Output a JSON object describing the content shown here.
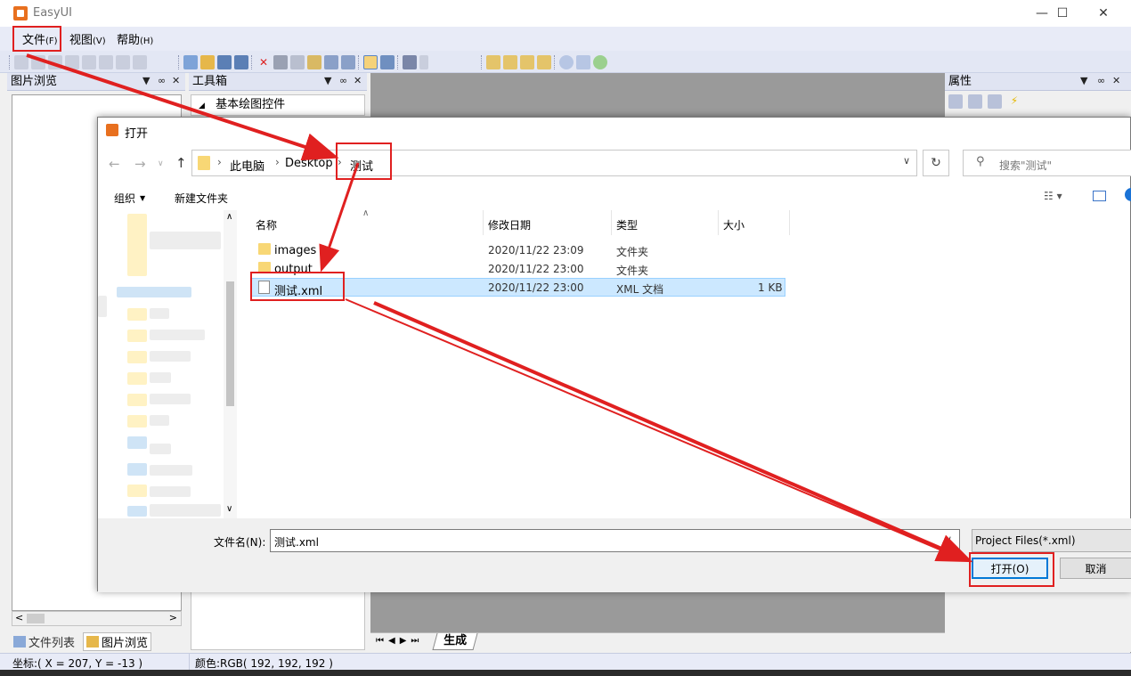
{
  "app": {
    "title": "EasyUI",
    "menu": [
      {
        "label": "文件",
        "key": "(F)"
      },
      {
        "label": "视图",
        "key": "(V)"
      },
      {
        "label": "帮助",
        "key": "(H)"
      }
    ]
  },
  "panels": {
    "picture_browse": {
      "title": "图片浏览"
    },
    "toolbox": {
      "title": "工具箱",
      "section": "基本绘图控件"
    },
    "properties": {
      "title": "属性"
    },
    "bottom_tabs": [
      "文件列表",
      "图片浏览"
    ],
    "canvas_tab": "生成"
  },
  "dialog": {
    "title": "打开",
    "breadcrumb": [
      "此电脑",
      "Desktop",
      "测试"
    ],
    "search_placeholder": "搜索\"测试\"",
    "organize": "组织",
    "new_folder": "新建文件夹",
    "columns": [
      "名称",
      "修改日期",
      "类型",
      "大小"
    ],
    "files": [
      {
        "name": "images",
        "date": "2020/11/22 23:09",
        "type": "文件夹",
        "size": "",
        "kind": "folder"
      },
      {
        "name": "output",
        "date": "2020/11/22 23:00",
        "type": "文件夹",
        "size": "",
        "kind": "folder"
      },
      {
        "name": "测试.xml",
        "date": "2020/11/22 23:00",
        "type": "XML 文档",
        "size": "1 KB",
        "kind": "xml",
        "selected": true
      }
    ],
    "filename_label": "文件名(N):",
    "filename_value": "测试.xml",
    "filetype": "Project Files(*.xml)",
    "open_button": "打开(O)",
    "cancel_button": "取消"
  },
  "status": {
    "coords": "坐标:( X = 207, Y = -13 )",
    "color": "颜色:RGB( 192, 192, 192 )"
  },
  "colors": {
    "annotation": "#e02020",
    "selection": "#cce8ff",
    "accent": "#0078d7"
  }
}
